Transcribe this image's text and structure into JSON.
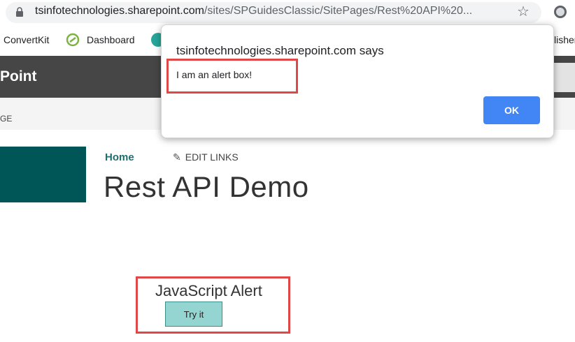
{
  "browser": {
    "url_host": "tsinfotechnologies.sharepoint.com",
    "url_path": "/sites/SPGuidesClassic/SitePages/Rest%20API%20...",
    "bookmarks": [
      {
        "label": "ConvertKit"
      },
      {
        "label": "Dashboard"
      },
      {
        "label": "lisher"
      }
    ]
  },
  "suitebar": {
    "title": "Point"
  },
  "ribbon": {
    "label": "GE"
  },
  "page": {
    "nav_home": "Home",
    "edit_links": "EDIT LINKS",
    "title": "Rest API Demo"
  },
  "webpart": {
    "heading": "JavaScript Alert",
    "button_label": "Try it"
  },
  "dialog": {
    "title": "tsinfotechnologies.sharepoint.com says",
    "message": "I am an alert box!",
    "ok_label": "OK"
  },
  "colors": {
    "suitebar": "#464646",
    "site_logo": "#005656",
    "ok_button": "#4285f4",
    "highlight": "#e04848",
    "try_button": "#94d4d1"
  }
}
